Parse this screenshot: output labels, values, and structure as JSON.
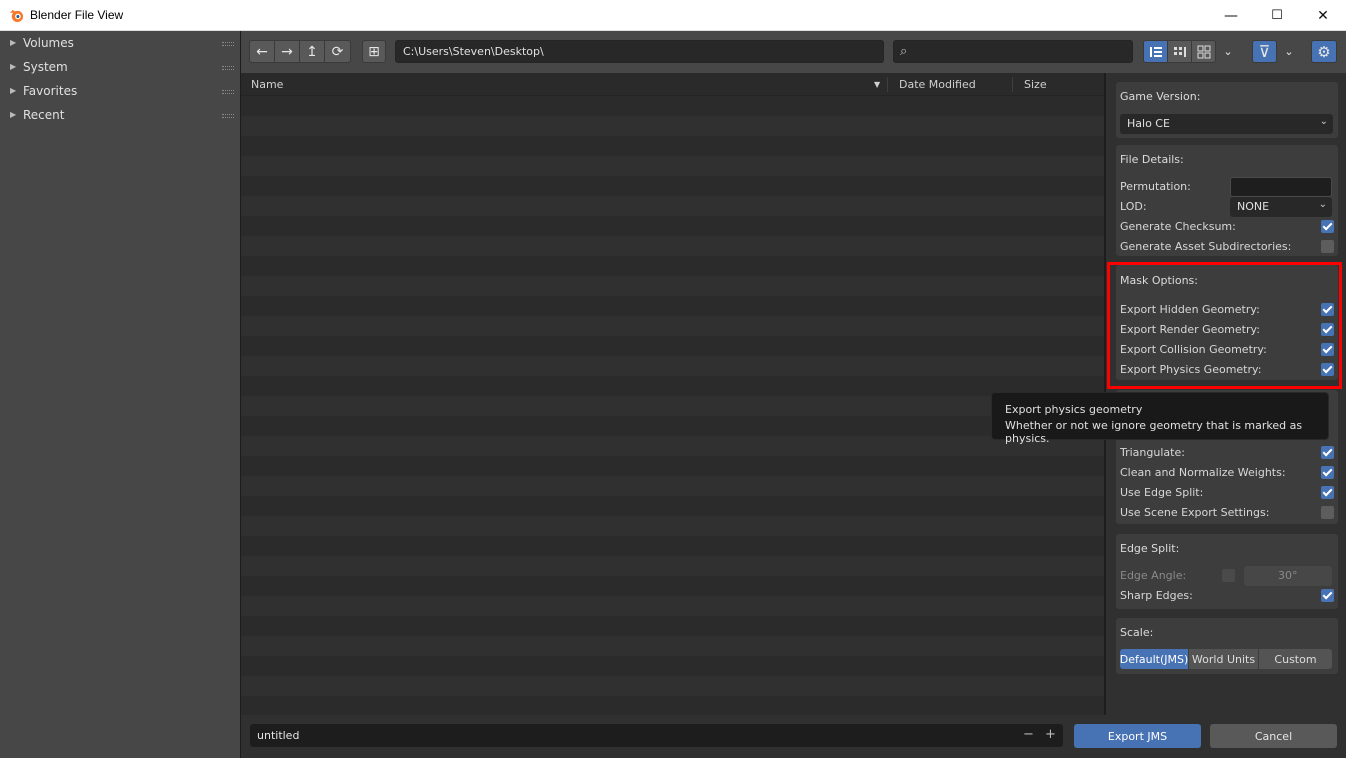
{
  "window": {
    "title": "Blender File View",
    "minimize": "—",
    "maximize": "☐",
    "close": "✕"
  },
  "sidebar": {
    "items": [
      {
        "label": "Volumes"
      },
      {
        "label": "System"
      },
      {
        "label": "Favorites"
      },
      {
        "label": "Recent"
      }
    ]
  },
  "toolbar": {
    "back": "←",
    "forward": "→",
    "parent": "↥",
    "refresh": "⟳",
    "new_folder": "⊞",
    "path": "C:\\Users\\Steven\\Desktop\\",
    "search_placeholder": "",
    "filter": "⊽",
    "settings": "⚙"
  },
  "file_list": {
    "columns": [
      {
        "label": "Name"
      },
      {
        "label": "Date Modified"
      },
      {
        "label": "Size"
      }
    ],
    "sort_indicator": "▼"
  },
  "panel": {
    "game_version": {
      "title": "Game Version:",
      "value": "Halo CE"
    },
    "file_details": {
      "title": "File Details:",
      "permutation_label": "Permutation:",
      "permutation_value": "",
      "lod_label": "LOD:",
      "lod_value": "NONE",
      "generate_checksum_label": "Generate Checksum:",
      "generate_checksum": true,
      "asset_subdirs_label": "Generate Asset Subdirectories:",
      "asset_subdirs": false
    },
    "mask_options": {
      "title": "Mask Options:",
      "hidden_label": "Export Hidden Geometry:",
      "render_label": "Export Render Geometry:",
      "collision_label": "Export Collision Geometry:",
      "physics_label": "Export Physics Geometry:"
    },
    "scene_options": {
      "triangulate_label": "Triangulate:",
      "clean_label": "Clean and Normalize Weights:",
      "edge_split_label": "Use Edge Split:",
      "scene_export_label": "Use Scene Export Settings:"
    },
    "edge_split": {
      "title": "Edge Split:",
      "angle_label": "Edge Angle:",
      "angle_value": "30°",
      "sharp_label": "Sharp Edges:"
    },
    "scale": {
      "title": "Scale:",
      "options": [
        "Default(JMS)",
        "World Units",
        "Custom"
      ],
      "selected": "Default(JMS)"
    }
  },
  "tooltip": {
    "title": "Export physics geometry",
    "description": "Whether or not we ignore geometry that is marked as physics."
  },
  "bottom": {
    "filename": "untitled",
    "minus": "−",
    "plus": "+",
    "export_label": "Export JMS",
    "cancel_label": "Cancel"
  },
  "colors": {
    "accent": "#4772b3",
    "highlight": "#ff0000"
  }
}
